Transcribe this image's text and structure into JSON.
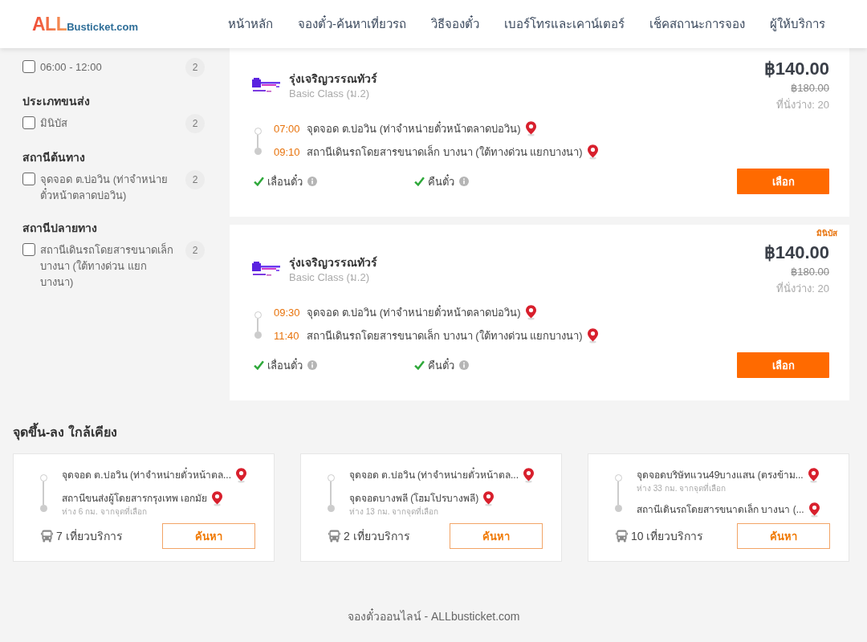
{
  "header": {
    "logo": {
      "accent": "ALL",
      "name": "Busticket.com"
    },
    "nav": [
      {
        "label": "หน้าหลัก"
      },
      {
        "label": "จองตั๋ว-ค้นหาเที่ยวรถ"
      },
      {
        "label": "วิธีจองตั๋ว"
      },
      {
        "label": "เบอร์โทรและเคาน์เตอร์"
      },
      {
        "label": "เช็คสถานะการจอง"
      },
      {
        "label": "ผู้ให้บริการ"
      }
    ]
  },
  "filters": [
    {
      "options": [
        {
          "label": "06:00 - 12:00",
          "checked": false,
          "count": "2"
        }
      ]
    },
    {
      "heading": "ประเภทขนส่ง",
      "options": [
        {
          "label": "มินิบัส",
          "checked": false,
          "count": "2"
        }
      ]
    },
    {
      "heading": "สถานีต้นทาง",
      "options": [
        {
          "label": "จุดจอด ต.บ่อวิน (ท่าจำหน่ายตั๋วหน้าตลาดบ่อวิน)",
          "checked": false,
          "count": "2"
        }
      ]
    },
    {
      "heading": "สถานีปลายทาง",
      "options": [
        {
          "label": "สถานีเดินรถโดยสารขนาดเล็ก บางนา (ใต้ทางด่วน แยกบางนา)",
          "checked": false,
          "count": "2"
        }
      ]
    }
  ],
  "trips": [
    {
      "operator": "รุ่งเจริญวรรณทัวร์",
      "class": "Basic Class (ม.2)",
      "price": "฿140.00",
      "old_price": "฿180.00",
      "seats": "ที่นั่งว่าง: 20",
      "stops": [
        {
          "time": "07:00",
          "place": "จุดจอด ต.บ่อวิน (ท่าจำหน่ายตั๋วหน้าตลาดบ่อวิน)"
        },
        {
          "time": "09:10",
          "place": "สถานีเดินรถโดยสารขนาดเล็ก บางนา (ใต้ทางด่วน แยกบางนา)"
        }
      ],
      "features": [
        {
          "label": "เลื่อนตั๋ว",
          "available": true
        },
        {
          "label": "คืนตั๋ว",
          "available": true
        }
      ],
      "button": "เลือก"
    },
    {
      "tag": "มินิบัส",
      "operator": "รุ่งเจริญวรรณทัวร์",
      "class": "Basic Class (ม.2)",
      "price": "฿140.00",
      "old_price": "฿180.00",
      "seats": "ที่นั่งว่าง: 20",
      "stops": [
        {
          "time": "09:30",
          "place": "จุดจอด ต.บ่อวิน (ท่าจำหน่ายตั๋วหน้าตลาดบ่อวิน)"
        },
        {
          "time": "11:40",
          "place": "สถานีเดินรถโดยสารขนาดเล็ก บางนา (ใต้ทางด่วน แยกบางนา)"
        }
      ],
      "features": [
        {
          "label": "เลื่อนตั๋ว",
          "available": true
        },
        {
          "label": "คืนตั๋ว",
          "available": true
        }
      ],
      "button": "เลือก"
    }
  ],
  "nearby": {
    "title": "จุดขึ้น-ลง ใกล้เคียง",
    "routes": [
      {
        "stops": [
          {
            "place": "จุดจอด ต.บ่อวิน (ท่าจำหน่ายตั๋วหน้าตล..."
          },
          {
            "place": "สถานีขนส่งผู้โดยสารกรุงเทพ เอกมัย",
            "distance": "ห่าง 6 กม. จากจุดที่เลือก"
          }
        ],
        "trips": "7 เที่ยวบริการ",
        "button": "ค้นหา"
      },
      {
        "stops": [
          {
            "place": "จุดจอด ต.บ่อวิน (ท่าจำหน่ายตั๋วหน้าตล..."
          },
          {
            "place": "จุดจอดบางพลี (โฮมโปรบางพลี)",
            "distance": "ห่าง 13 กม. จากจุดที่เลือก"
          }
        ],
        "trips": "2 เที่ยวบริการ",
        "button": "ค้นหา"
      },
      {
        "stops": [
          {
            "place": "จุดจอดบริษัทแวน49บางแสน (ตรงข้าม...",
            "distance": "ห่าง 33 กม. จากจุดที่เลือก"
          },
          {
            "place": "สถานีเดินรถโดยสารขนาดเล็ก บางนา (..."
          }
        ],
        "trips": "10 เที่ยวบริการ",
        "button": "ค้นหา"
      }
    ]
  },
  "footer": "จองตั๋วออนไลน์ - ALLbusticket.com"
}
